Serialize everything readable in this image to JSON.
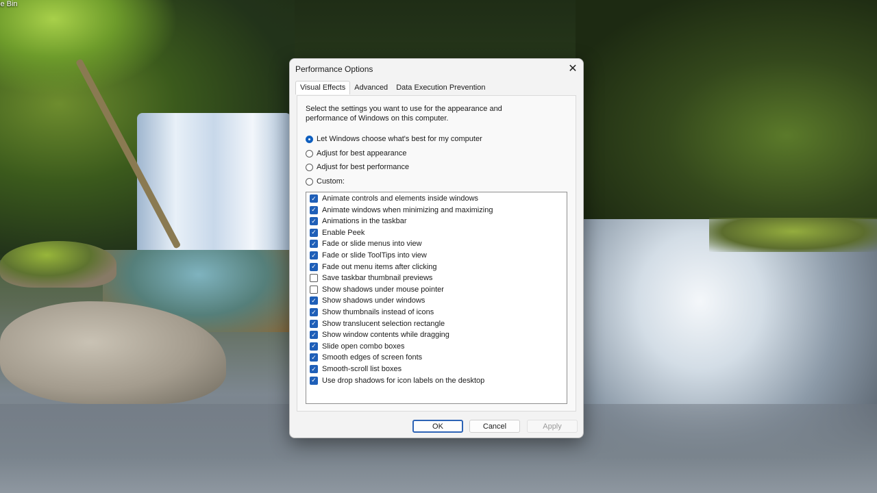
{
  "desktop": {
    "icon_label": "le Bin"
  },
  "dialog": {
    "title": "Performance Options",
    "close_glyph": "✕",
    "tabs": [
      {
        "label": "Visual Effects",
        "active": true
      },
      {
        "label": "Advanced",
        "active": false
      },
      {
        "label": "Data Execution Prevention",
        "active": false
      }
    ],
    "intro": "Select the settings you want to use for the appearance and performance of Windows on this computer.",
    "options": [
      {
        "label": "Let Windows choose what's best for my computer",
        "selected": true
      },
      {
        "label": "Adjust for best appearance",
        "selected": false
      },
      {
        "label": "Adjust for best performance",
        "selected": false
      },
      {
        "label": "Custom:",
        "selected": false
      }
    ],
    "effects": [
      {
        "label": "Animate controls and elements inside windows",
        "checked": true
      },
      {
        "label": "Animate windows when minimizing and maximizing",
        "checked": true
      },
      {
        "label": "Animations in the taskbar",
        "checked": true
      },
      {
        "label": "Enable Peek",
        "checked": true
      },
      {
        "label": "Fade or slide menus into view",
        "checked": true
      },
      {
        "label": "Fade or slide ToolTips into view",
        "checked": true
      },
      {
        "label": "Fade out menu items after clicking",
        "checked": true
      },
      {
        "label": "Save taskbar thumbnail previews",
        "checked": false
      },
      {
        "label": "Show shadows under mouse pointer",
        "checked": false
      },
      {
        "label": "Show shadows under windows",
        "checked": true
      },
      {
        "label": "Show thumbnails instead of icons",
        "checked": true
      },
      {
        "label": "Show translucent selection rectangle",
        "checked": true
      },
      {
        "label": "Show window contents while dragging",
        "checked": true
      },
      {
        "label": "Slide open combo boxes",
        "checked": true
      },
      {
        "label": "Smooth edges of screen fonts",
        "checked": true
      },
      {
        "label": "Smooth-scroll list boxes",
        "checked": true
      },
      {
        "label": "Use drop shadows for icon labels on the desktop",
        "checked": true
      }
    ],
    "buttons": {
      "ok": "OK",
      "cancel": "Cancel",
      "apply": "Apply"
    },
    "check_glyph": "✓",
    "accent_color": "#1f5fb8"
  }
}
